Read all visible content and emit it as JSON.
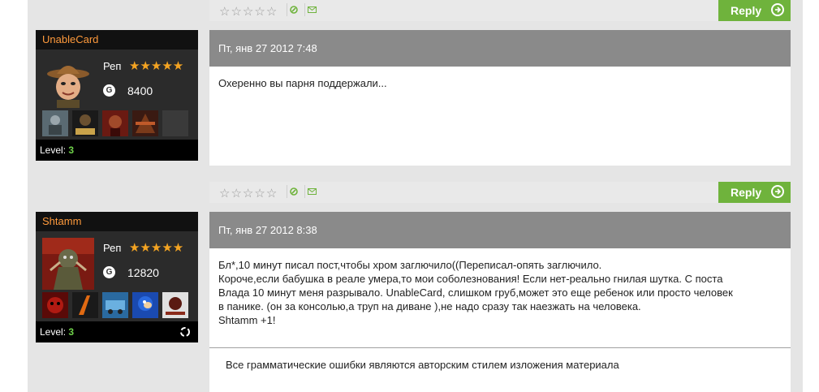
{
  "reply_label": "Reply",
  "posts": [
    {
      "username": "UnableCard",
      "rep_label": "Реп",
      "score": "8400",
      "g_icon": "G",
      "level_label": "Level:",
      "level": "3",
      "date": "Пт, янв 27 2012 7:48",
      "lines": [
        "Охеренно вы парня поддержали..."
      ]
    },
    {
      "username": "Shtamm",
      "rep_label": "Реп",
      "score": "12820",
      "g_icon": "G",
      "level_label": "Level:",
      "level": "3",
      "date": "Пт, янв 27 2012 8:38",
      "lines": [
        "Бл*,10 минут писал пост,чтобы хром заглючило((Переписал-опять заглючило.",
        "Короче,если бабушка в реале умера,то мои соболезнования! Если нет-реально гнилая шутка. С поста",
        "Влада 10 минут меня разрывало. UnableCard, слишком груб,может это еще ребенок или просто человек",
        "в панике. (он за консолью,а труп на диване ),не надо сразу так наезжать на человека.",
        "Shtamm +1!"
      ],
      "signature": "Все грамматические ошибки являются авторским стилем изложения материала"
    }
  ],
  "colors": {
    "accent_green": "#6fb33c",
    "username_orange": "#ff9a3c",
    "rep_star": "#f4a422",
    "level_green": "#6fd14a",
    "post_header_gray": "#8a8a8a"
  }
}
